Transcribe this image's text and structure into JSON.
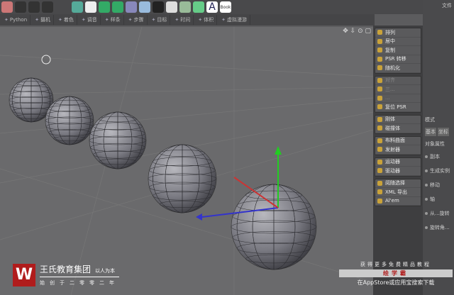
{
  "toolbar_icons": [
    "cube-icon",
    "clapper-icon",
    "clapper-icon",
    "clapper-icon",
    "sphere-icon",
    "spline-icon",
    "generator-icon",
    "cloner-icon",
    "deformer-icon",
    "floor-icon",
    "camera-icon",
    "light-icon",
    "tag-icon",
    "text-icon"
  ],
  "toolbar_text": {
    "a": "A",
    "book": "Book"
  },
  "subbar": [
    "Python",
    "摄机",
    "着色",
    "调音",
    "样条",
    "步骤",
    "目标",
    "时间",
    "体积",
    "虚拟漫游"
  ],
  "right_panel": {
    "file": "文件",
    "mode": "模式",
    "tabs": [
      "基本",
      "坐标"
    ],
    "object_props": "对象属性",
    "props": [
      "副本",
      "生成实例",
      "移动",
      "轴",
      "从...旋转",
      "旋转角..."
    ]
  },
  "mograph_menu": {
    "group1": [
      "排列",
      "居中",
      "复制",
      "PSR 转移",
      "随机化"
    ],
    "group2": [
      "对齐",
      "三...",
      "...",
      "复位 PSR"
    ],
    "group3": [
      "刚体",
      "碰撞体"
    ],
    "group4": [
      "布料曲面",
      "发射器"
    ],
    "group5": [
      "运动器",
      "驱动器"
    ],
    "group6": [
      "阅随选择",
      "XML 导出",
      "Al'em"
    ]
  },
  "watermark": {
    "logo_letter": "W",
    "company": "王氏教育集团",
    "slogan": "以人为本",
    "founded": "始创于二零零二年",
    "promo_top": "获得更多免费精品教程",
    "promo_app": "绘学霸",
    "promo_bottom": "在AppStore或应用宝搜索下载"
  }
}
